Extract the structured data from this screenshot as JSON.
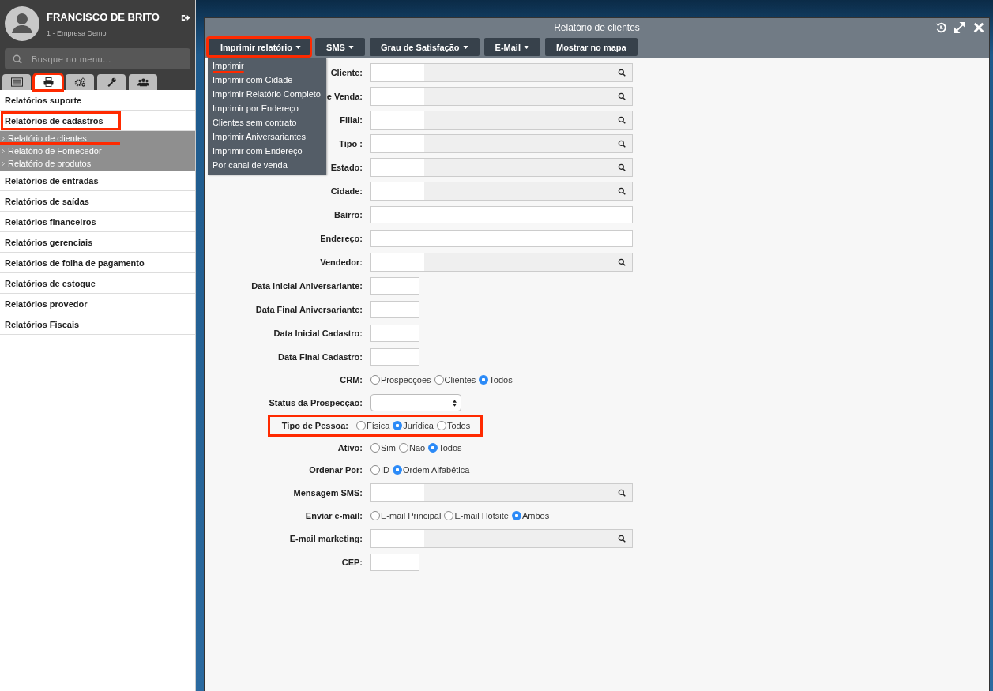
{
  "sidebar": {
    "user": {
      "name": "FRANCISCO DE BRITO",
      "company": "1 - Empresa Demo"
    },
    "search": {
      "placeholder": "Busque no menu..."
    },
    "tabs": [
      {
        "selected": false,
        "highlighted": false
      },
      {
        "selected": true,
        "highlighted": true
      },
      {
        "selected": false,
        "highlighted": false
      },
      {
        "selected": false,
        "highlighted": false
      },
      {
        "selected": false,
        "highlighted": false
      }
    ],
    "groups": [
      {
        "label": "Relatórios suporte",
        "highlighted": false
      },
      {
        "label": "Relatórios de cadastros",
        "expanded": true,
        "highlighted": true,
        "children": [
          {
            "label": "Relatório de clientes",
            "underlined": true
          },
          {
            "label": "Relatório de Fornecedor",
            "underlined": false
          },
          {
            "label": "Relatório de produtos",
            "underlined": false
          }
        ]
      },
      {
        "label": "Relatórios de entradas",
        "highlighted": false
      },
      {
        "label": "Relatórios de saídas",
        "highlighted": false
      },
      {
        "label": "Relatórios financeiros",
        "highlighted": false
      },
      {
        "label": "Relatórios gerenciais",
        "highlighted": false
      },
      {
        "label": "Relatórios de folha de pagamento",
        "highlighted": false
      },
      {
        "label": "Relatórios de estoque",
        "highlighted": false
      },
      {
        "label": "Relatórios provedor",
        "highlighted": false
      },
      {
        "label": "Relatórios Fiscais",
        "highlighted": false
      }
    ]
  },
  "dialog": {
    "title": "Relatório de clientes",
    "toolbar": [
      {
        "label": "Imprimir relatório",
        "dropdown": true,
        "highlighted": true
      },
      {
        "label": "SMS",
        "dropdown": true,
        "highlighted": false
      },
      {
        "label": "Grau de Satisfação",
        "dropdown": true,
        "highlighted": false
      },
      {
        "label": "E-Mail",
        "dropdown": true,
        "highlighted": false
      },
      {
        "label": "Mostrar no mapa",
        "dropdown": false,
        "highlighted": false
      }
    ],
    "menu": [
      {
        "label": "Imprimir",
        "underlined": true
      },
      {
        "label": "Imprimir com Cidade",
        "underlined": false
      },
      {
        "label": "Imprimir Relatório Completo",
        "underlined": false
      },
      {
        "label": "Imprimir por Endereço",
        "underlined": false
      },
      {
        "label": "Clientes sem contrato",
        "underlined": false
      },
      {
        "label": "Imprimir Aniversariantes",
        "underlined": false
      },
      {
        "label": "Imprimir com Endereço",
        "underlined": false
      },
      {
        "label": "Por canal de venda",
        "underlined": false
      }
    ],
    "fields": [
      {
        "label": "Cliente:",
        "kind": "lookup",
        "highlighted": false
      },
      {
        "label": "e Venda:",
        "kind": "lookup",
        "highlighted": false
      },
      {
        "label": "Filial:",
        "kind": "lookup",
        "highlighted": false
      },
      {
        "label": "Tipo :",
        "kind": "lookup",
        "highlighted": false
      },
      {
        "label": "Estado:",
        "kind": "lookup",
        "highlighted": false
      },
      {
        "label": "Cidade:",
        "kind": "lookup",
        "highlighted": false
      },
      {
        "label": "Bairro:",
        "kind": "text",
        "highlighted": false
      },
      {
        "label": "Endereço:",
        "kind": "text",
        "highlighted": false
      },
      {
        "label": "Vendedor:",
        "kind": "lookup",
        "highlighted": false
      },
      {
        "label": "Data Inicial Aniversariante:",
        "kind": "short",
        "highlighted": false
      },
      {
        "label": "Data Final Aniversariante:",
        "kind": "short",
        "highlighted": false
      },
      {
        "label": "Data Inicial Cadastro:",
        "kind": "short",
        "highlighted": false
      },
      {
        "label": "Data Final Cadastro:",
        "kind": "short",
        "highlighted": false
      },
      {
        "label": "CRM:",
        "kind": "radio",
        "highlighted": false,
        "options": [
          {
            "label": "Prospecções",
            "selected": false
          },
          {
            "label": "Clientes",
            "selected": false
          },
          {
            "label": "Todos",
            "selected": true
          }
        ]
      },
      {
        "label": "Status da Prospecção:",
        "kind": "select",
        "highlighted": false,
        "value": "---"
      },
      {
        "label": "Tipo de Pessoa:",
        "kind": "radio",
        "highlighted": true,
        "options": [
          {
            "label": "Física",
            "selected": false
          },
          {
            "label": "Jurídica",
            "selected": true
          },
          {
            "label": "Todos",
            "selected": false
          }
        ]
      },
      {
        "label": "Ativo:",
        "kind": "radio",
        "highlighted": false,
        "options": [
          {
            "label": "Sim",
            "selected": false
          },
          {
            "label": "Não",
            "selected": false
          },
          {
            "label": "Todos",
            "selected": true
          }
        ]
      },
      {
        "label": "Ordenar Por:",
        "kind": "radio",
        "highlighted": false,
        "options": [
          {
            "label": "ID",
            "selected": false
          },
          {
            "label": "Ordem Alfabética",
            "selected": true
          }
        ]
      },
      {
        "label": "Mensagem SMS:",
        "kind": "lookup",
        "highlighted": false
      },
      {
        "label": "Enviar e-mail:",
        "kind": "radio",
        "highlighted": false,
        "options": [
          {
            "label": "E-mail Principal",
            "selected": false
          },
          {
            "label": "E-mail Hotsite",
            "selected": false
          },
          {
            "label": "Ambos",
            "selected": true
          }
        ]
      },
      {
        "label": "E-mail marketing:",
        "kind": "lookup",
        "highlighted": false
      },
      {
        "label": "CEP:",
        "kind": "short",
        "highlighted": false
      }
    ]
  }
}
